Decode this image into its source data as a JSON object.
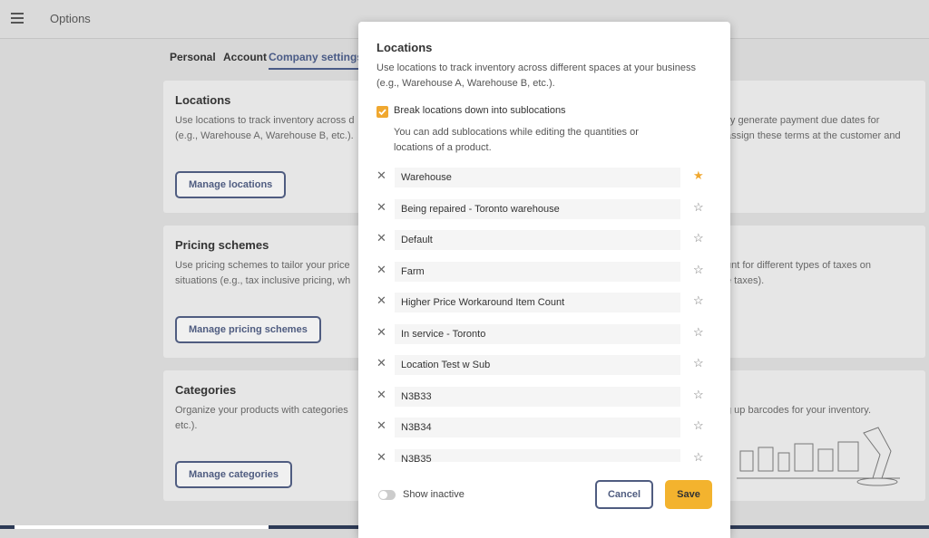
{
  "header": {
    "title": "Options"
  },
  "tabs": [
    {
      "label": "Personal"
    },
    {
      "label": "Account"
    },
    {
      "label": "Company settings"
    }
  ],
  "cards": {
    "locations": {
      "title": "Locations",
      "desc_line1": "Use locations to track inventory across d",
      "desc_line2": "(e.g., Warehouse A, Warehouse B, etc.).",
      "button": "Manage locations",
      "right_line1": "lly generate payment due dates for",
      "right_line2": "assign these terms at the customer and"
    },
    "pricing": {
      "title": "Pricing schemes",
      "desc_line1": "Use pricing schemes to tailor your price",
      "desc_line2": "situations (e.g., tax inclusive pricing, wh",
      "button": "Manage pricing schemes",
      "right_line1": "unt for different types of taxes on",
      "right_line2": "e taxes)."
    },
    "categories": {
      "title": "Categories",
      "desc_line1": "Organize your products with categories",
      "desc_line2": "etc.).",
      "button": "Manage categories",
      "right_line1": "g up barcodes for your inventory."
    }
  },
  "modal": {
    "title": "Locations",
    "description": "Use locations to track inventory across different spaces at your business (e.g., Warehouse A, Warehouse B, etc.).",
    "sublocations_checkbox": {
      "label": "Break locations down into sublocations",
      "checked": true
    },
    "sublocations_desc": "You can add sublocations while editing the quantities or locations of a product.",
    "locations": [
      {
        "name": "Warehouse",
        "starred": true
      },
      {
        "name": "Being repaired - Toronto warehouse",
        "starred": false
      },
      {
        "name": "Default",
        "starred": false
      },
      {
        "name": "Farm",
        "starred": false
      },
      {
        "name": "Higher Price Workaround Item Count",
        "starred": false
      },
      {
        "name": "In service - Toronto",
        "starred": false
      },
      {
        "name": "Location Test w Sub",
        "starred": false
      },
      {
        "name": "N3B33",
        "starred": false
      },
      {
        "name": "N3B34",
        "starred": false
      },
      {
        "name": "N3B35",
        "starred": false
      }
    ],
    "icons": {
      "remove": "close-icon",
      "star": "star-icon"
    },
    "show_inactive_label": "Show inactive",
    "cancel_label": "Cancel",
    "save_label": "Save",
    "colors": {
      "accent": "#f3b32e",
      "primary": "#4f5c80"
    }
  }
}
